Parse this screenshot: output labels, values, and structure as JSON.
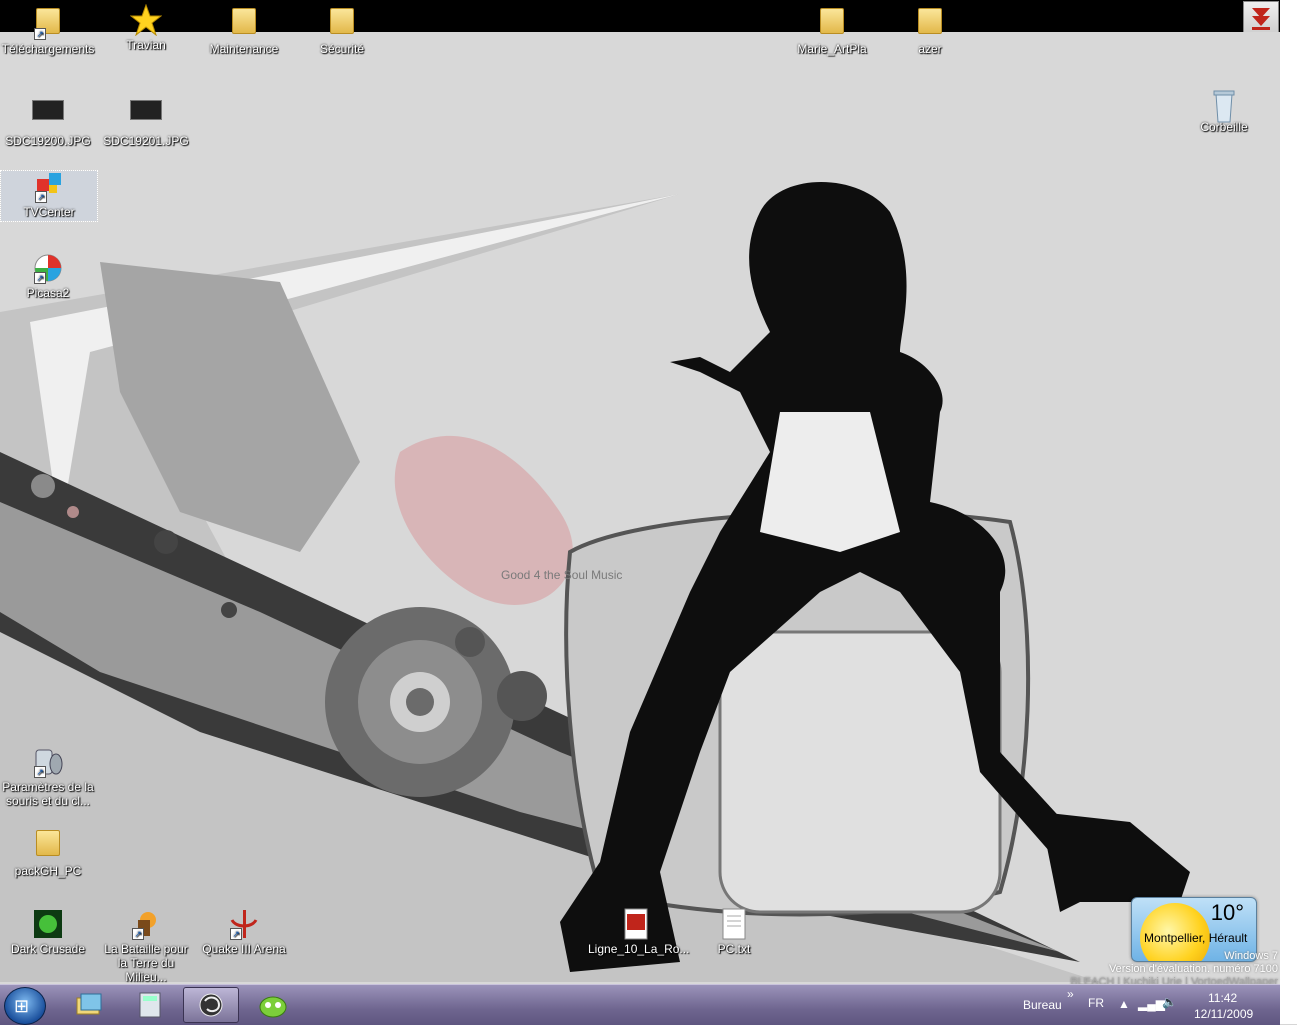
{
  "desktop": {
    "icons": [
      {
        "label": "Téléchargements",
        "icon": "downloads-folder-icon"
      },
      {
        "label": "Travian",
        "icon": "star-icon"
      },
      {
        "label": "Maintenance",
        "icon": "folder-icon"
      },
      {
        "label": "Sécurité",
        "icon": "folder-icon"
      },
      {
        "label": "Marie_ArtPla",
        "icon": "folder-icon"
      },
      {
        "label": "azer",
        "icon": "folder-icon"
      },
      {
        "label": "SDC19200.JPG",
        "icon": "image-file-icon"
      },
      {
        "label": "SDC19201.JPG",
        "icon": "image-file-icon"
      },
      {
        "label": "Corbeille",
        "icon": "recycle-bin-icon"
      },
      {
        "label": "TVCenter",
        "icon": "tvcenter-icon"
      },
      {
        "label": "Picasa2",
        "icon": "picasa-icon"
      },
      {
        "label": "Paramètres de la souris et du cl...",
        "icon": "mouse-settings-icon"
      },
      {
        "label": "packGH_PC",
        "icon": "folder-icon"
      },
      {
        "label": "Dark Crusade",
        "icon": "dark-crusade-icon"
      },
      {
        "label": "La Bataille pour la Terre du Milieu...",
        "icon": "game-icon"
      },
      {
        "label": "Quake III Arena",
        "icon": "quake-icon"
      },
      {
        "label": "Ligne_10_La_Ro...",
        "icon": "pdf-file-icon"
      },
      {
        "label": "PC.txt",
        "icon": "text-file-icon"
      }
    ],
    "wallpaper_text": "Good 4 the Soul Music"
  },
  "weather_gadget": {
    "temperature": "10°",
    "city": "Montpellier, Hérault"
  },
  "watermark": {
    "line1": "Windows 7",
    "line2": "Version d'évaluation. numéro 7100",
    "line3": "BLEACH | Kuchiki Urie | VortoedWallpaper"
  },
  "taskbar": {
    "pinned": [
      {
        "name": "windows-explorer-icon"
      },
      {
        "name": "calculator-icon"
      },
      {
        "name": "firefox-icon"
      },
      {
        "name": "chat-app-icon"
      }
    ],
    "toolbar_label": "Bureau",
    "toolbar_chevron": "»",
    "language": "FR",
    "time": "11:42",
    "date": "12/11/2009"
  },
  "colors": {
    "taskbar": "#6f6690",
    "desktop_background": "#d6d6d6",
    "topbar": "#000000"
  }
}
